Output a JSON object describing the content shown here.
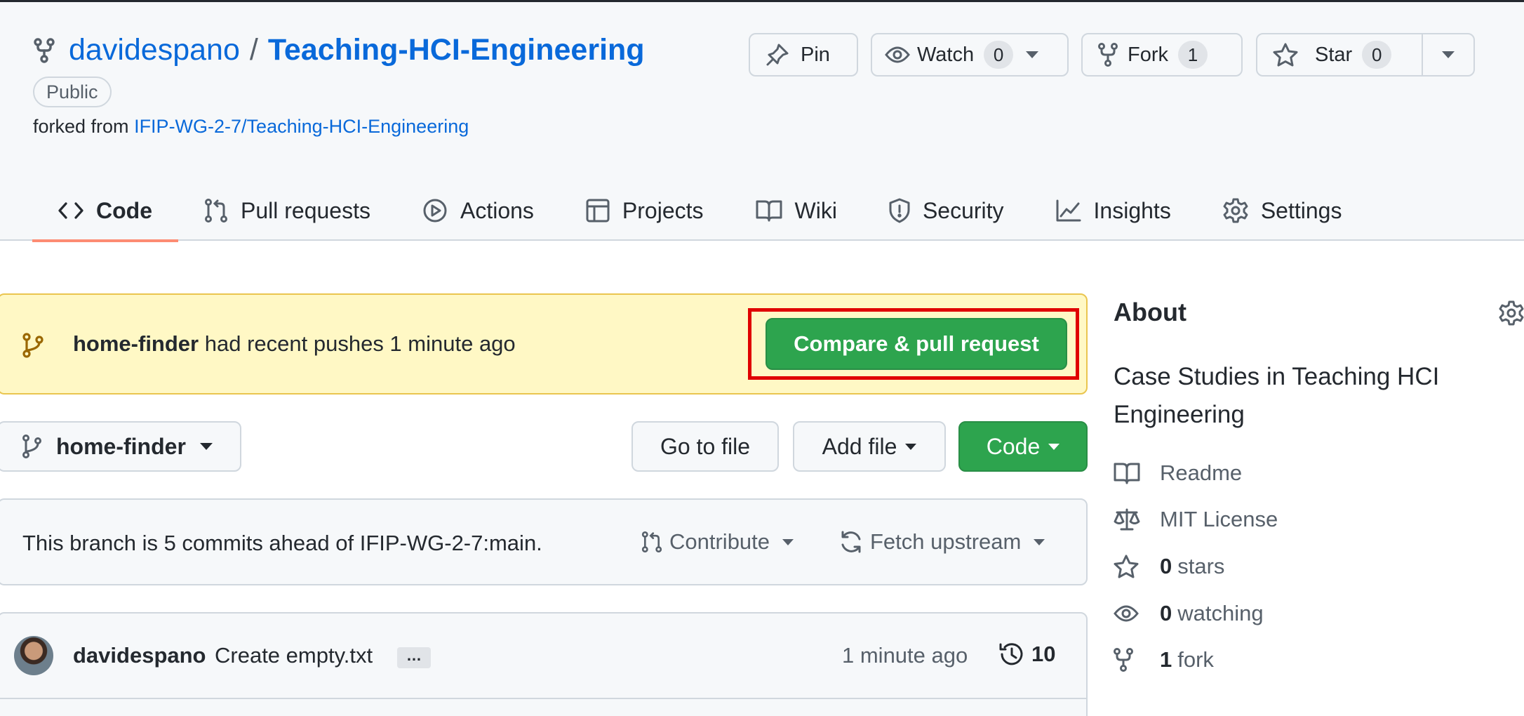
{
  "repo": {
    "owner": "davidespano",
    "separator": "/",
    "name": "Teaching-HCI-Engineering",
    "visibility": "Public",
    "forked_from_prefix": "forked from",
    "forked_from_link": "IFIP-WG-2-7/Teaching-HCI-Engineering"
  },
  "actions": {
    "pin": "Pin",
    "watch": "Watch",
    "watch_count": "0",
    "fork": "Fork",
    "fork_count": "1",
    "star": "Star",
    "star_count": "0"
  },
  "tabs": [
    {
      "label": "Code",
      "icon": "code-icon",
      "active": true
    },
    {
      "label": "Pull requests",
      "icon": "pull-request-icon"
    },
    {
      "label": "Actions",
      "icon": "play-icon"
    },
    {
      "label": "Projects",
      "icon": "table-icon"
    },
    {
      "label": "Wiki",
      "icon": "book-icon"
    },
    {
      "label": "Security",
      "icon": "shield-icon"
    },
    {
      "label": "Insights",
      "icon": "graph-icon"
    },
    {
      "label": "Settings",
      "icon": "gear-icon"
    }
  ],
  "banner": {
    "branch": "home-finder",
    "message": "had recent pushes 1 minute ago",
    "button": "Compare & pull request"
  },
  "toolbar": {
    "branch": "home-finder",
    "go_to_file": "Go to file",
    "add_file": "Add file",
    "code": "Code"
  },
  "ahead": {
    "text": "This branch is 5 commits ahead of IFIP-WG-2-7:main.",
    "contribute": "Contribute",
    "fetch_upstream": "Fetch upstream"
  },
  "commit": {
    "author": "davidespano",
    "message": "Create empty.txt",
    "ellipsis": "…",
    "time": "1 minute ago",
    "count": "10"
  },
  "about": {
    "title": "About",
    "description": "Case Studies in Teaching HCI Engineering",
    "readme": "Readme",
    "license": "MIT License",
    "stars_count": "0",
    "stars_label": "stars",
    "watching_count": "0",
    "watching_label": "watching",
    "forks_count": "1",
    "forks_label": "fork"
  },
  "colors": {
    "link": "#0969da",
    "primary_button": "#2da44e",
    "banner_bg": "#fff8c5",
    "highlight": "#e00000",
    "active_tab_underline": "#fd8c73"
  }
}
